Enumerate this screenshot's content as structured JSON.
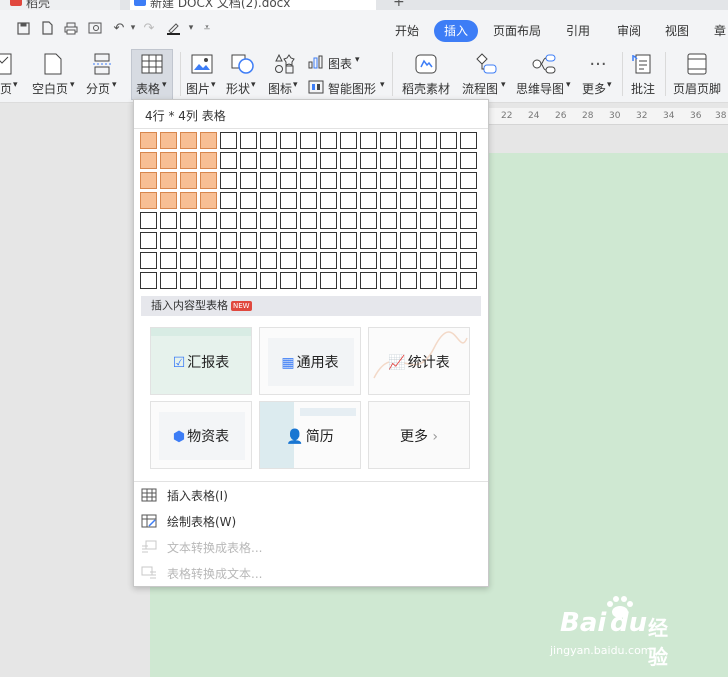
{
  "titlebar": {
    "app_tab": "稻壳",
    "doc_tab": "新建 DOCX 文档(2).docx",
    "plus": "+"
  },
  "menu": {
    "items": [
      "开始",
      "插入",
      "页面布局",
      "引用",
      "审阅",
      "视图",
      "章"
    ],
    "active": "插入"
  },
  "ribbon": {
    "page_partial": "页",
    "blank_page": "空白页",
    "page_break": "分页",
    "table": "表格",
    "picture": "图片",
    "shape": "形状",
    "icon": "图标",
    "chart": "图表",
    "smart_graphic": "智能图形",
    "docer_material": "稻壳素材",
    "flowchart": "流程图",
    "mindmap": "思维导图",
    "more": "更多",
    "comment": "批注",
    "header_footer": "页眉页脚"
  },
  "ruler": {
    "ticks": [
      "22",
      "24",
      "26",
      "28",
      "30",
      "32",
      "34",
      "36",
      "38"
    ]
  },
  "dropdown": {
    "grid_title": "4行 * 4列 表格",
    "grid": {
      "rows": 8,
      "cols": 17,
      "selected_rows": 4,
      "selected_cols": 4
    },
    "content_section": "插入内容型表格",
    "new_badge": "NEW",
    "cards": [
      "汇报表",
      "通用表",
      "统计表",
      "物资表",
      "简历",
      "更多"
    ],
    "card_more_arrow": "›",
    "actions": {
      "insert_table": "插入表格(I)",
      "draw_table": "绘制表格(W)",
      "text_to_table": "文本转换成表格...",
      "table_to_text": "表格转换成文本..."
    }
  },
  "watermark": {
    "brand": "Bai",
    "brand2": "du",
    "jingyan": "经验",
    "url": "jingyan.baidu.com"
  },
  "colors": {
    "accent": "#3d7df6",
    "selected_cell": "#f8bf94",
    "page_bg": "#cfe8d2"
  }
}
